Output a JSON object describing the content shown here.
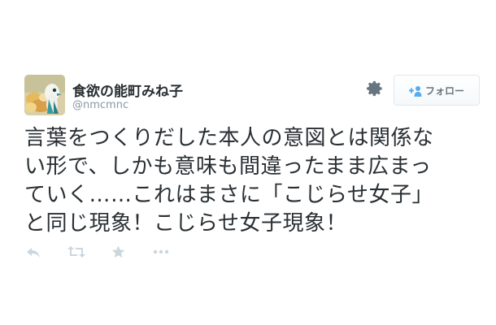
{
  "tweet": {
    "display_name": "食欲の能町みね子",
    "handle": "@nmcmnc",
    "text_lines": [
      "言葉をつくりだした本人の意図とは関係な",
      "い形で、しかも意味も間違ったまま広まっ",
      "ていく……これはまさに「こじらせ女子」",
      "と同じ現象！こじらせ女子現象！"
    ]
  },
  "header": {
    "settings_icon": "gear-icon",
    "follow_icon": "add-user-icon",
    "follow_label": "フォロー"
  },
  "actions": [
    {
      "name": "reply",
      "icon": "reply-icon"
    },
    {
      "name": "retweet",
      "icon": "retweet-icon"
    },
    {
      "name": "favorite",
      "icon": "star-icon"
    },
    {
      "name": "more",
      "icon": "more-icon"
    }
  ],
  "colors": {
    "text": "#292f33",
    "muted": "#8899a6",
    "icon": "#ccd6dd",
    "follow_icon": "#55acee",
    "button_border": "#e1e8ed"
  }
}
